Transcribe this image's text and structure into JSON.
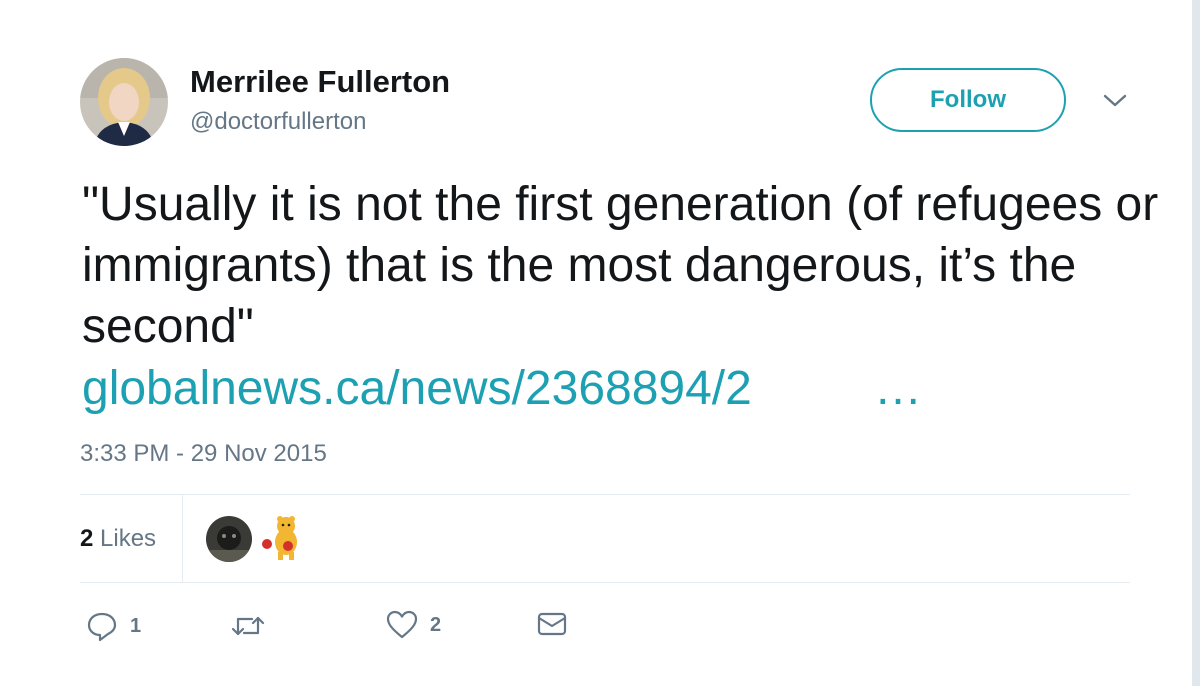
{
  "tweet": {
    "author_name": "Merrilee Fullerton",
    "author_handle": "@doctorfullerton",
    "follow_label": "Follow",
    "text": "\"Usually it is not the first generation (of refugees or immigrants) that is the most dangerous, it’s the second\"",
    "link_text": "globalnews.ca/news/2368894/2",
    "link_ellipsis": "…",
    "timestamp": "3:33 PM - 29 Nov 2015"
  },
  "stats": {
    "likes_count": "2",
    "likes_label": "Likes"
  },
  "actions": {
    "reply_count": "1",
    "retweet_count": "",
    "like_count": "2"
  },
  "icons": {
    "reply": "reply-icon",
    "retweet": "retweet-icon",
    "like": "heart-icon",
    "dm": "envelope-icon",
    "menu": "chevron-down-icon"
  },
  "colors": {
    "accent": "#1da1b2",
    "text": "#14171a",
    "muted": "#657786"
  }
}
